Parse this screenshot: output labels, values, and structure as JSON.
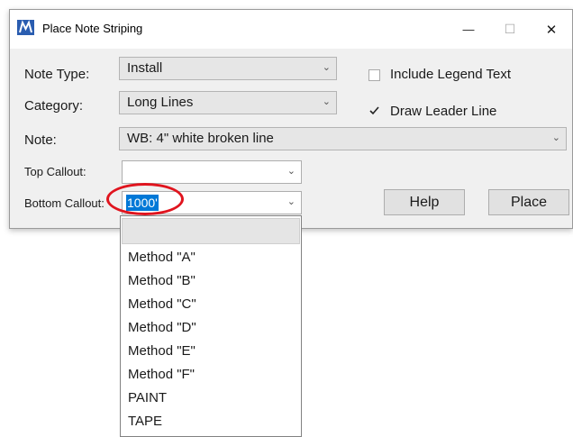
{
  "window": {
    "title": "Place Note Striping",
    "controls": {
      "minimize": "—",
      "maximize": "☐",
      "close": "✕"
    }
  },
  "form": {
    "note_type": {
      "label": "Note Type:",
      "value": "Install"
    },
    "category": {
      "label": "Category:",
      "value": "Long Lines"
    },
    "note": {
      "label": "Note:",
      "value": "WB:  4\" white broken line"
    },
    "top_callout": {
      "label": "Top Callout:",
      "value": ""
    },
    "bottom_callout": {
      "label": "Bottom Callout:",
      "value": "1000'"
    },
    "include_legend": {
      "label": "Include Legend Text",
      "checked": false
    },
    "draw_leader": {
      "label": "Draw Leader Line",
      "checked": true
    },
    "help_label": "Help",
    "place_label": "Place"
  },
  "dropdown": {
    "items": [
      "Method \"A\"",
      "Method \"B\"",
      "Method \"C\"",
      "Method \"D\"",
      "Method \"E\"",
      "Method \"F\"",
      "PAINT",
      "TAPE"
    ]
  },
  "colors": {
    "highlight": "#e0141e",
    "selection": "#0078d7"
  }
}
